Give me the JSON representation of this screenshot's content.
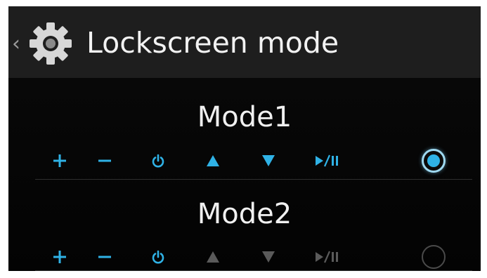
{
  "header": {
    "title": "Lockscreen mode",
    "back_icon": "chevron-left-icon",
    "settings_icon": "gear-icon"
  },
  "modes": [
    {
      "name": "Mode1",
      "selected": true,
      "controls": [
        {
          "icon": "plus-icon",
          "label": "+",
          "enabled": true
        },
        {
          "icon": "minus-icon",
          "label": "−",
          "enabled": true
        },
        {
          "icon": "power-icon",
          "label": "power",
          "enabled": true
        },
        {
          "icon": "arrow-up-icon",
          "label": "up",
          "enabled": true
        },
        {
          "icon": "arrow-down-icon",
          "label": "down",
          "enabled": true
        },
        {
          "icon": "play-pause-icon",
          "label": "play/pause",
          "enabled": true
        }
      ]
    },
    {
      "name": "Mode2",
      "selected": false,
      "controls": [
        {
          "icon": "plus-icon",
          "label": "+",
          "enabled": true
        },
        {
          "icon": "minus-icon",
          "label": "−",
          "enabled": true
        },
        {
          "icon": "power-icon",
          "label": "power",
          "enabled": true
        },
        {
          "icon": "arrow-up-icon",
          "label": "up",
          "enabled": false
        },
        {
          "icon": "arrow-down-icon",
          "label": "down",
          "enabled": false
        },
        {
          "icon": "play-pause-icon",
          "label": "play/pause",
          "enabled": false
        }
      ]
    }
  ],
  "colors": {
    "accent": "#2fb2e6",
    "disabled": "#5a5a5a",
    "text": "#f0f0f0",
    "app_bar": "#1e1e1e",
    "background": "#060606"
  }
}
